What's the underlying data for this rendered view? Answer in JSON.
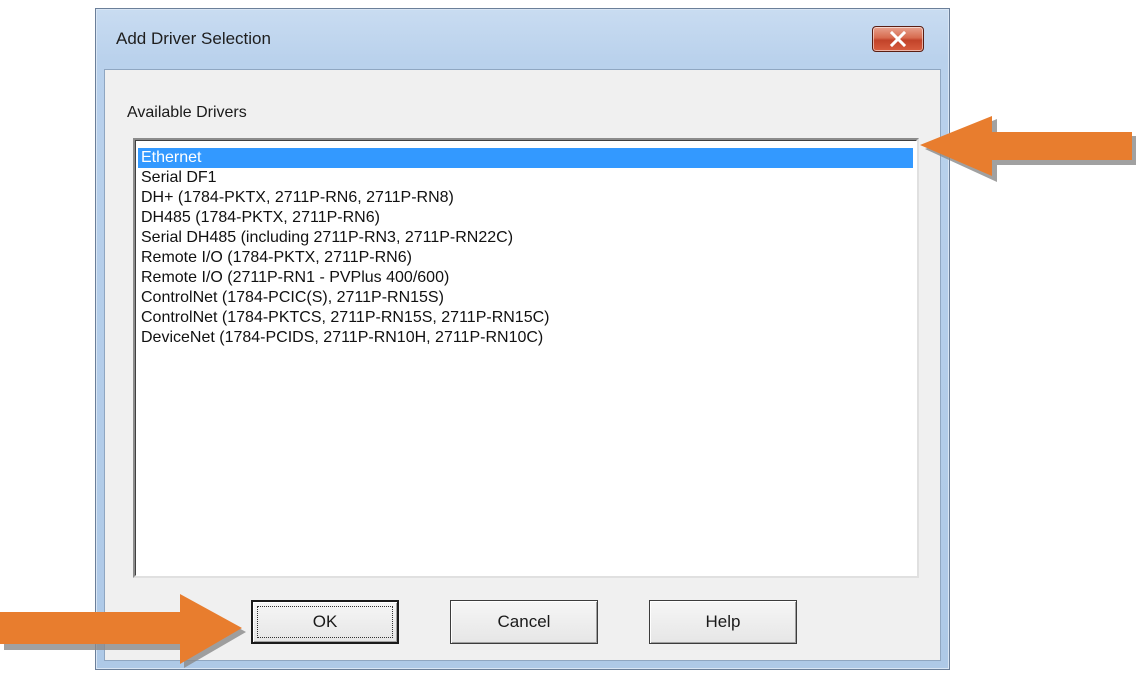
{
  "dialog": {
    "title": "Add Driver Selection",
    "close_icon": "close-icon"
  },
  "drivers": {
    "label": "Available Drivers",
    "items": [
      "Ethernet",
      "Serial DF1",
      "DH+ (1784-PKTX, 2711P-RN6, 2711P-RN8)",
      "DH485 (1784-PKTX, 2711P-RN6)",
      "Serial DH485 (including 2711P-RN3, 2711P-RN22C)",
      "Remote I/O (1784-PKTX, 2711P-RN6)",
      "Remote I/O (2711P-RN1 - PVPlus 400/600)",
      "ControlNet (1784-PCIC(S), 2711P-RN15S)",
      "ControlNet (1784-PKTCS, 2711P-RN15S, 2711P-RN15C)",
      "DeviceNet (1784-PCIDS, 2711P-RN10H, 2711P-RN10C)"
    ],
    "selected": "Ethernet"
  },
  "buttons": {
    "ok": "OK",
    "cancel": "Cancel",
    "help": "Help"
  },
  "annotations": {
    "arrow_color": "#e87d2e",
    "arrow_shadow": "#8a8a8a"
  }
}
